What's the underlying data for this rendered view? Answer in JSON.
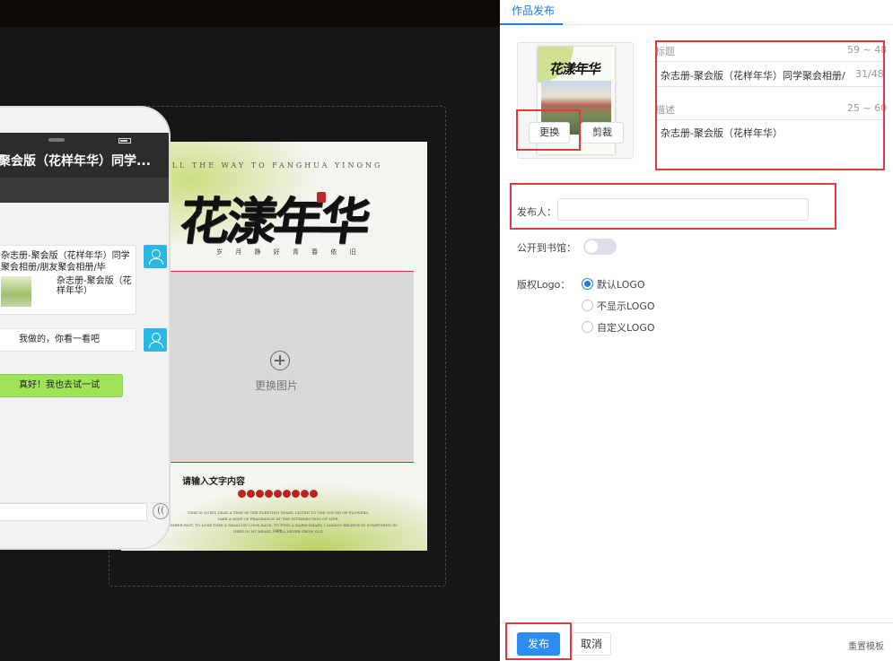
{
  "poster": {
    "tagline": "ALL THE WAY TO FANGHUA YINONG",
    "title": "花漾年华",
    "subline": "岁 月 静 好 青 春 依 旧",
    "change_image": "更换图片",
    "text_prompt": "请输入文字内容",
    "small_lines": [
      "TIME IS QUIET, LEAD A TIME IN THE FLEETING YEARS, LISTEN TO THE SOUND OF FLOWERS,",
      "TAKE A WISP OF FRAGRANCE AT THE INTERSECTION OF LIFE,",
      "REMEMBER PAST, TO LOSE TIME A SHALLOW LOOK BACK, TO FIND A WARM HEART, I ALWAYS BELIEVE IN SOMETHING IN LIFE,",
      "DEEP IN MY HEART, I WILL NEVER GROW OLD"
    ]
  },
  "phone": {
    "nav_title": "聚会版（花样年华）同学...",
    "msg1_text": "杂志册-聚会版（花样年华）同学聚会相册/朋友聚会相册/毕",
    "msg1_desc": "杂志册-聚会版（花样年华）",
    "msg2_text": "我做的，你看一看吧",
    "msg3_text": "真好！我也去试一试",
    "voice_icon": "(("
  },
  "panel": {
    "tab_label": "作品发布",
    "cover": {
      "replace_label": "更换",
      "crop_label": "剪裁"
    },
    "title_field": {
      "label": "标题",
      "range": "59 ~ 48",
      "value": "杂志册-聚会版（花样年华）同学聚会相册/",
      "count": "31/48"
    },
    "desc_field": {
      "label": "描述",
      "range": "25 ~ 60",
      "value": "杂志册-聚会版（花样年华）"
    },
    "publisher_label": "发布人：",
    "library_label": "公开到书馆：",
    "logo_label": "版权Logo：",
    "logo_options": [
      "默认LOGO",
      "不显示LOGO",
      "自定义LOGO"
    ],
    "publish_label": "发布",
    "cancel_label": "取消",
    "reset_label": "重置模板"
  },
  "colors": {
    "accent": "#2d8cf0",
    "highlight": "#e23a3a",
    "avatar": "#27b8e6",
    "bubble_green": "#9fe35b"
  }
}
